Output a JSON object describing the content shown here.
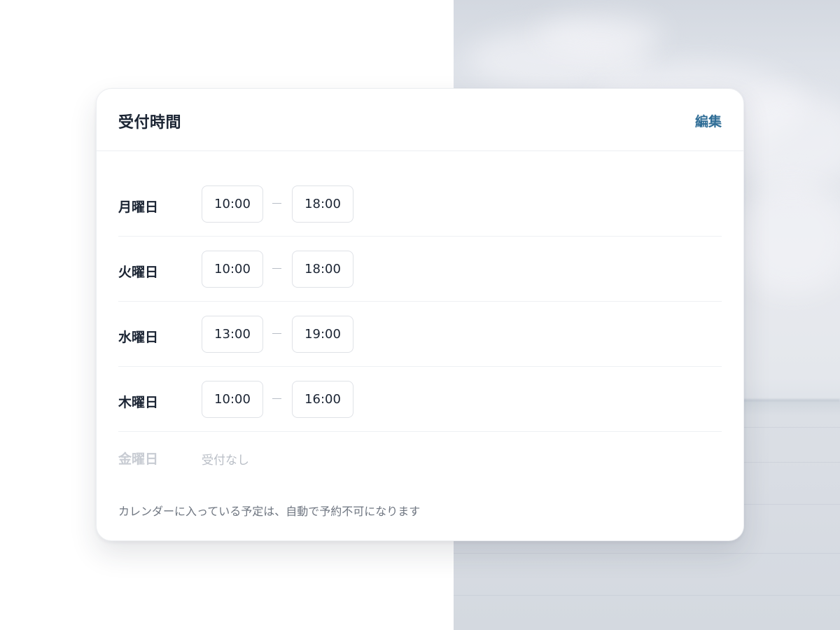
{
  "card": {
    "title": "受付時間",
    "edit_label": "編集"
  },
  "schedule": [
    {
      "day": "月曜日",
      "start": "10:00",
      "end": "18:00"
    },
    {
      "day": "火曜日",
      "start": "10:00",
      "end": "18:00"
    },
    {
      "day": "水曜日",
      "start": "13:00",
      "end": "19:00"
    },
    {
      "day": "木曜日",
      "start": "10:00",
      "end": "16:00"
    }
  ],
  "closed_day": {
    "day": "金曜日",
    "status": "受付なし"
  },
  "note": "カレンダーに入っている予定は、自動で予約不可になります",
  "colors": {
    "accent": "#2f6d96",
    "text": "#1b2433",
    "muted": "#6e7580"
  }
}
